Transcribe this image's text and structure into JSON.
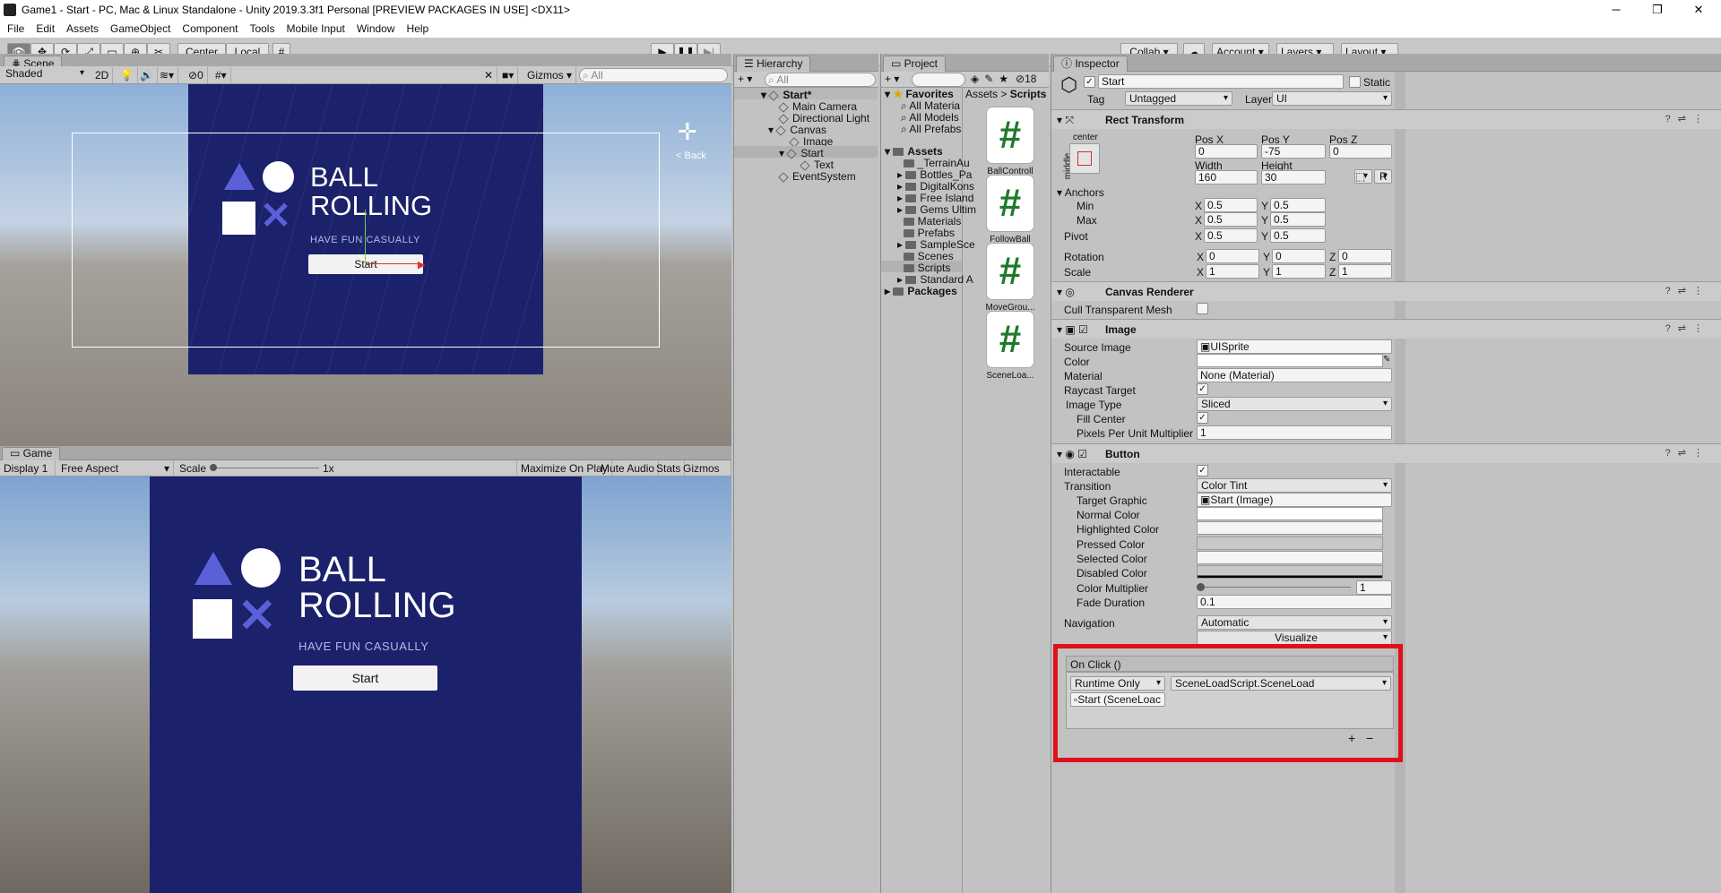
{
  "window": {
    "title": "Game1 - Start - PC, Mac & Linux Standalone - Unity 2019.3.3f1 Personal [PREVIEW PACKAGES IN USE] <DX11>",
    "minimize": "─",
    "maximize": "❐",
    "close": "✕"
  },
  "menu": [
    "File",
    "Edit",
    "Assets",
    "GameObject",
    "Component",
    "Tools",
    "Mobile Input",
    "Window",
    "Help"
  ],
  "toolbar": {
    "pivot_label": "Center",
    "space_label": "Local",
    "collab_label": "Collab ▾",
    "account_label": "Account",
    "layers_label": "Layers",
    "layout_label": "Layout"
  },
  "scene": {
    "tab": "Scene",
    "shading": "Shaded",
    "mode2d": "2D",
    "fx_count": "0",
    "gizmos": "Gizmos",
    "search_placeholder": "All",
    "back_label": "< Back",
    "canvas_color": "#1b216b",
    "preview": {
      "title1": "BALL",
      "title2": "ROLLING",
      "subtitle": "HAVE FUN CASUALLY",
      "button": "Start"
    }
  },
  "game": {
    "tab": "Game",
    "display": "Display 1",
    "aspect": "Free Aspect",
    "scale_label": "Scale",
    "scale_value": "1x",
    "scale_fraction": 0.0,
    "maximize": "Maximize On Play",
    "mute": "Mute Audio",
    "stats": "Stats",
    "gizmos": "Gizmos",
    "preview": {
      "title1": "BALL",
      "title2": "ROLLING",
      "subtitle": "HAVE FUN CASUALLY",
      "button": "Start"
    }
  },
  "hierarchy": {
    "tab": "Hierarchy",
    "search_placeholder": "All",
    "items": [
      {
        "label": "Start*"
      },
      {
        "label": "Main Camera"
      },
      {
        "label": "Directional Light"
      },
      {
        "label": "Canvas"
      },
      {
        "label": "Image"
      },
      {
        "label": "Start"
      },
      {
        "label": "Text"
      },
      {
        "label": "EventSystem"
      }
    ]
  },
  "project": {
    "tab": "Project",
    "count": "18",
    "favorites": "Favorites",
    "fav_items": [
      "All Materia",
      "All Models",
      "All Prefabs"
    ],
    "assets": "Assets",
    "asset_items": [
      "_TerrainAu",
      "Bottles_Pa",
      "DigitalKons",
      "Free Island",
      "Gems Ultim",
      "Materials",
      "Prefabs",
      "SampleSce",
      "Scenes",
      "Scripts",
      "Standard A"
    ],
    "packages": "Packages",
    "breadcrumb_root": "Assets",
    "breadcrumb_sep": ">",
    "breadcrumb_current": "Scripts",
    "scripts": [
      "BallControll",
      "FollowBall",
      "MoveGrou...",
      "SceneLoa..."
    ]
  },
  "inspector": {
    "tab": "Inspector",
    "object_name": "Start",
    "static_label": "Static",
    "tag_label": "Tag",
    "tag_value": "Untagged",
    "layer_label": "Layer",
    "layer_value": "UI",
    "rect": {
      "title": "Rect Transform",
      "anchor_top": "center",
      "anchor_side": "middle",
      "posx_label": "Pos X",
      "posx": "0",
      "posy_label": "Pos Y",
      "posy": "-75",
      "posz_label": "Pos Z",
      "posz": "0",
      "width_label": "Width",
      "width": "160",
      "height_label": "Height",
      "height": "30",
      "r_btn": "R",
      "anchors": "Anchors",
      "min": "Min",
      "min_x": "0.5",
      "min_y": "0.5",
      "max": "Max",
      "max_x": "0.5",
      "max_y": "0.5",
      "pivot": "Pivot",
      "pivot_x": "0.5",
      "pivot_y": "0.5",
      "rotation": "Rotation",
      "rot_x": "0",
      "rot_y": "0",
      "rot_z": "0",
      "scale": "Scale",
      "scale_x": "1",
      "scale_y": "1",
      "scale_z": "1",
      "x": "X",
      "y": "Y",
      "z": "Z"
    },
    "canvas_renderer": {
      "title": "Canvas Renderer",
      "cull_label": "Cull Transparent Mesh"
    },
    "image": {
      "title": "Image",
      "source_label": "Source Image",
      "source": "UISprite",
      "color_label": "Color",
      "material_label": "Material",
      "material": "None (Material)",
      "raycast_label": "Raycast Target",
      "type_label": "Image Type",
      "type": "Sliced",
      "fill_label": "Fill Center",
      "ppu_label": "Pixels Per Unit Multiplier",
      "ppu": "1"
    },
    "button": {
      "title": "Button",
      "interactable_label": "Interactable",
      "transition_label": "Transition",
      "transition": "Color Tint",
      "target_label": "Target Graphic",
      "target": "Start (Image)",
      "normal_label": "Normal Color",
      "highlighted_label": "Highlighted Color",
      "pressed_label": "Pressed Color",
      "selected_label": "Selected Color",
      "disabled_label": "Disabled Color",
      "multiplier_label": "Color Multiplier",
      "multiplier": "1",
      "multiplier_fraction": 0.0,
      "fade_label": "Fade Duration",
      "fade": "0.1",
      "nav_label": "Navigation",
      "nav": "Automatic",
      "visualize": "Visualize"
    },
    "onclick": {
      "title": "On Click ()",
      "runtime": "Runtime Only",
      "function": "SceneLoadScript.SceneLoad",
      "object": "Start (SceneLoac",
      "plus": "+",
      "minus": "−",
      "highlight_color": "#e0101a"
    }
  }
}
